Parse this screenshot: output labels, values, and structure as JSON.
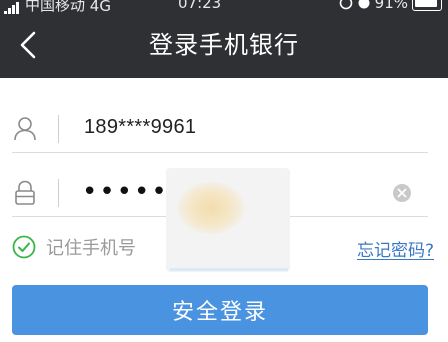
{
  "status_bar": {
    "carrier": "中国移动",
    "network": "4G",
    "time": "07:23",
    "battery": "91%"
  },
  "header": {
    "title": "登录手机银行",
    "back_icon": "chevron-left-icon",
    "background": "#2f3033"
  },
  "form": {
    "phone": {
      "value": "189****9961",
      "icon": "user-icon"
    },
    "password": {
      "value": "•••••••",
      "icon": "lock-icon",
      "clear_icon": "clear-icon"
    }
  },
  "remember": {
    "label": "记住手机号",
    "checked": true,
    "icon": "check-circle-icon",
    "color": "#3bb54a"
  },
  "forgot_link": "忘记密码?",
  "login_button": {
    "label": "安全登录",
    "color": "#4a93e0"
  }
}
